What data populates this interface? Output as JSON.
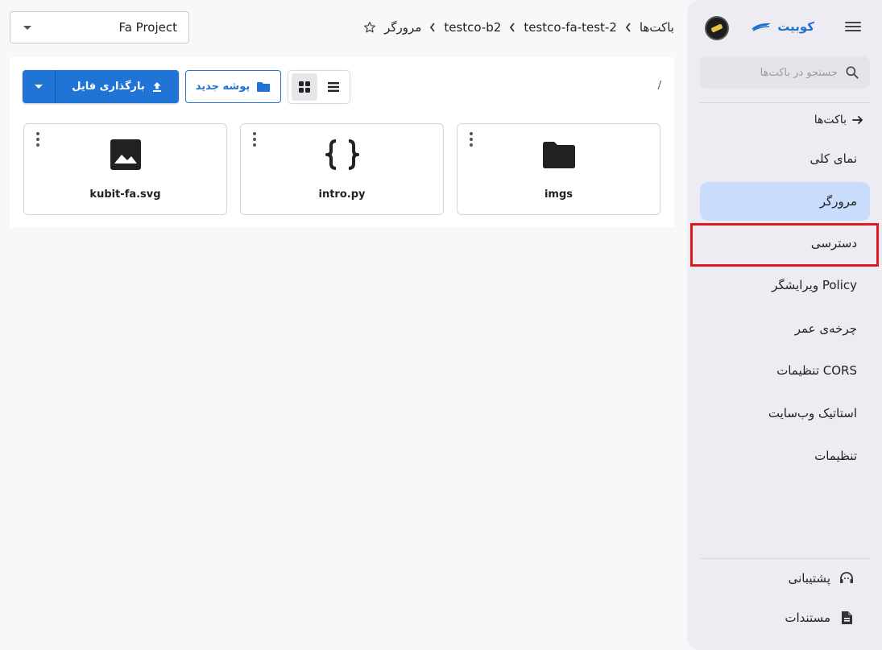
{
  "project": {
    "selected": "Fa Project"
  },
  "breadcrumb": {
    "items": [
      "باکت‌ها",
      "testco-fa-test-2",
      "testco-b2",
      "مرورگر"
    ]
  },
  "sidebar": {
    "brand": "کوبیت",
    "search_placeholder": "جستجو در باکت‌ها",
    "back_label": "باکت‌ها",
    "items": [
      {
        "label": "نمای کلی"
      },
      {
        "label": "مرورگر"
      },
      {
        "label": "دسترسی"
      },
      {
        "label": "ویرایشگر Policy"
      },
      {
        "label": "چرخه‌ی عمر"
      },
      {
        "label": "تنظیمات CORS"
      },
      {
        "label": "استاتیک وب‌سایت"
      },
      {
        "label": "تنظیمات"
      }
    ],
    "footer": [
      {
        "label": "پشتیبانی",
        "icon": "headset-icon"
      },
      {
        "label": "مستندات",
        "icon": "document-icon"
      }
    ]
  },
  "toolbar": {
    "upload_label": "بارگذاری فایل",
    "new_folder_label": "پوشه جدید",
    "path": "/"
  },
  "files": [
    {
      "name": "kubit-fa.svg",
      "icon": "image-icon"
    },
    {
      "name": "intro.py",
      "icon": "code-braces-icon"
    },
    {
      "name": "imgs",
      "icon": "folder-icon"
    }
  ],
  "colors": {
    "accent": "#1f74d6",
    "active_nav": "#c9dcfb",
    "highlight": "#e0191e",
    "brand": "#1f6fd0"
  }
}
